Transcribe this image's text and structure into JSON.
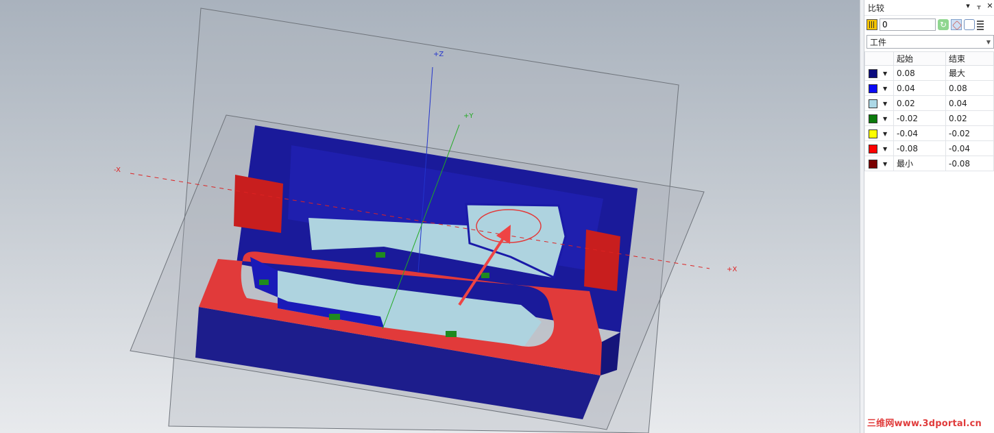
{
  "panel": {
    "title": "比较",
    "header_icons": [
      "▾",
      "ᚁ",
      "✕"
    ],
    "tolerance_value": "0",
    "target_select": "工件",
    "columns": [
      "起始",
      "结束"
    ],
    "ranges": [
      {
        "color": "#0b0b7e",
        "start": "0.08",
        "end": "最大"
      },
      {
        "color": "#0a0af5",
        "start": "0.04",
        "end": "0.08"
      },
      {
        "color": "#acd8e6",
        "start": "0.02",
        "end": "0.04"
      },
      {
        "color": "#0b7a0b",
        "start": "-0.02",
        "end": "0.02"
      },
      {
        "color": "#ffff00",
        "start": "-0.04",
        "end": "-0.02"
      },
      {
        "color": "#ff0000",
        "start": "-0.08",
        "end": "-0.04"
      },
      {
        "color": "#7a0000",
        "start": "最小",
        "end": "-0.08"
      }
    ]
  },
  "viewport": {
    "axis_labels": {
      "z": "+Z",
      "y": "+Y",
      "x_neg": "-X",
      "x_pos": "+X"
    }
  },
  "watermark": "三维网www.3dportal.cn"
}
